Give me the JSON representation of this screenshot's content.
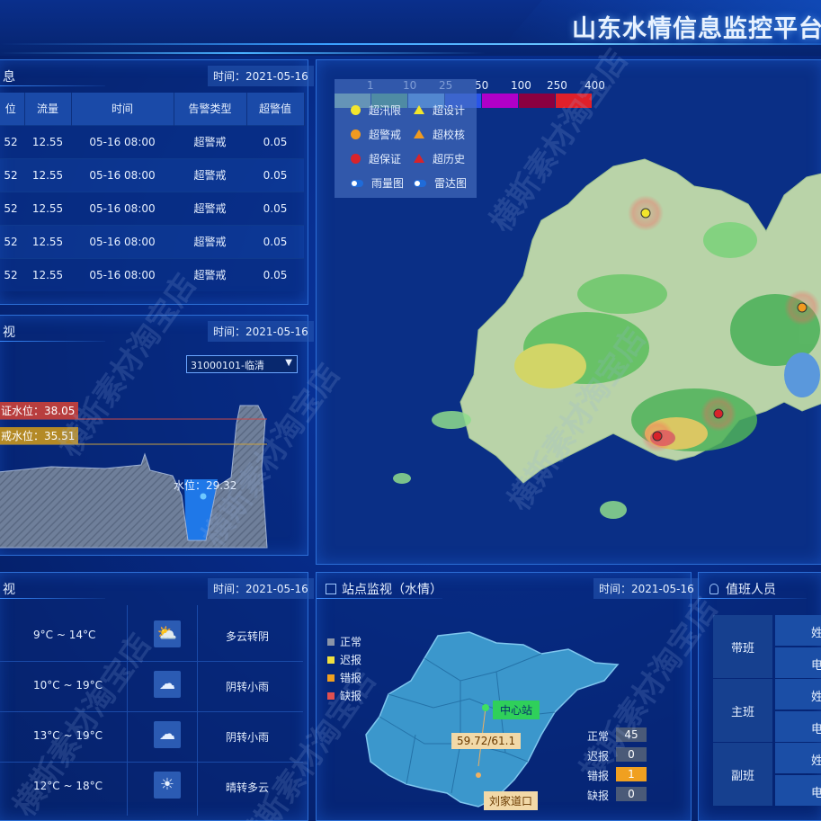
{
  "header": {
    "title": "山东水情信息监控平台"
  },
  "alarm_panel": {
    "title": "息",
    "time": "时间：2021-05-16",
    "columns": [
      "位",
      "流量",
      "时间",
      "告警类型",
      "超警值"
    ],
    "rows": [
      [
        "52",
        "12.55",
        "05-16 08:00",
        "超警戒",
        "0.05"
      ],
      [
        "52",
        "12.55",
        "05-16 08:00",
        "超警戒",
        "0.05"
      ],
      [
        "52",
        "12.55",
        "05-16 08:00",
        "超警戒",
        "0.05"
      ],
      [
        "52",
        "12.55",
        "05-16 08:00",
        "超警戒",
        "0.05"
      ],
      [
        "52",
        "12.55",
        "05-16 08:00",
        "超警戒",
        "0.05"
      ]
    ]
  },
  "section_panel": {
    "title": "视",
    "time": "时间：2021-05-16",
    "station_select": "31000101-临清",
    "guarantee_label": "证水位：38.05",
    "warning_label": "戒水位：35.51",
    "water_label": "水位：29.32"
  },
  "map": {
    "scale_labels": [
      "1",
      "10",
      "25",
      "50",
      "100",
      "250",
      "400"
    ],
    "scale_colors": [
      "#9fd9a8",
      "#5fbf72",
      "#69b4ef",
      "#2a55e8",
      "#b000c8",
      "#8b0040",
      "#e0202a"
    ],
    "legend": [
      {
        "label": "超汛限",
        "shape": "dot",
        "color": "#f2e62c"
      },
      {
        "label": "超设计",
        "shape": "tri",
        "color": "#f2e62c"
      },
      {
        "label": "超警戒",
        "shape": "dot",
        "color": "#f09a20"
      },
      {
        "label": "超校核",
        "shape": "tri",
        "color": "#f09a20"
      },
      {
        "label": "超保证",
        "shape": "dot",
        "color": "#d8232a"
      },
      {
        "label": "超历史",
        "shape": "tri",
        "color": "#d8232a"
      },
      {
        "label": "雨量图",
        "shape": "toggle",
        "color": "#1f6bd9"
      },
      {
        "label": "雷达图",
        "shape": "toggle",
        "color": "#1f6bd9"
      }
    ]
  },
  "weather_panel": {
    "title": "视",
    "time": "时间：2021-05-16",
    "rows": [
      {
        "temp": "9°C ~ 14°C",
        "icon": "partly-cloudy-icon",
        "desc": "多云转阴"
      },
      {
        "temp": "10°C ~ 19°C",
        "icon": "cloud-icon",
        "desc": "阴转小雨"
      },
      {
        "temp": "13°C ~ 19°C",
        "icon": "cloud-icon",
        "desc": "阴转小雨"
      },
      {
        "temp": "12°C ~ 18°C",
        "icon": "sun-icon",
        "desc": "晴转多云"
      }
    ]
  },
  "station_panel": {
    "title": "站点监视（水情）",
    "time": "时间：2021-05-16",
    "legend": [
      {
        "label": "正常",
        "color": "#8a94a8"
      },
      {
        "label": "迟报",
        "color": "#f0e040"
      },
      {
        "label": "错报",
        "color": "#f0a020"
      },
      {
        "label": "缺报",
        "color": "#e05050"
      }
    ],
    "center_label": "中心站",
    "reading_label": "59.72/61.1",
    "station_label": "刘家道口",
    "stats": [
      {
        "label": "正常",
        "value": "45",
        "color": "#4a5a78"
      },
      {
        "label": "迟报",
        "value": "0",
        "color": "#4a5a78"
      },
      {
        "label": "错报",
        "value": "1",
        "color": "#f0a020"
      },
      {
        "label": "缺报",
        "value": "0",
        "color": "#4a5a78"
      }
    ]
  },
  "duty_panel": {
    "title": "值班人员",
    "groups": [
      "带班",
      "主班",
      "副班"
    ],
    "names": [
      "姓",
      "电",
      "姓",
      "电",
      "姓",
      "电"
    ]
  },
  "watermark": "横斯素材淘宝店"
}
